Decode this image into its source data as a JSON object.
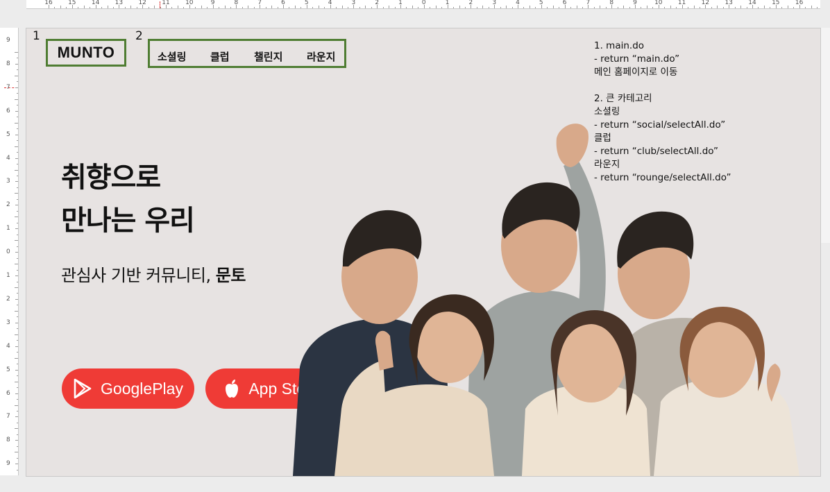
{
  "ruler": {
    "top_labels": [
      "16",
      "15",
      "14",
      "13",
      "12",
      "11",
      "10",
      "9",
      "8",
      "7",
      "6",
      "5",
      "4",
      "3",
      "2",
      "1",
      "0",
      "1",
      "2",
      "3",
      "4",
      "5",
      "6",
      "7",
      "8",
      "9",
      "10",
      "11",
      "12",
      "13",
      "14",
      "15",
      "16"
    ],
    "left_labels": [
      "9",
      "8",
      "7",
      "6",
      "5",
      "4",
      "3",
      "2",
      "1",
      "0",
      "1",
      "2",
      "3",
      "4",
      "5",
      "6",
      "7",
      "8",
      "9"
    ]
  },
  "slide": {
    "markers": {
      "logo": "1",
      "nav": "2"
    },
    "logo": "MUNTO",
    "nav": [
      "소셜링",
      "클럽",
      "챌린지",
      "라운지"
    ],
    "headline": [
      "취향으로",
      "만나는 우리"
    ],
    "subline": {
      "normal": "관심사 기반 커뮤니티, ",
      "bold": "문토"
    },
    "buttons": {
      "google": "GooglePlay",
      "apple": "App Store"
    },
    "notes": [
      "1. main.do",
      "- return “main.do”",
      "메인 홈페이지로 이동",
      "",
      "2. 큰 카테고리",
      "소셜링",
      "- return “social/selectAll.do”",
      "클럽",
      "- return “club/selectAll.do”",
      "라운지",
      "- return “rounge/selectAll.do”"
    ]
  },
  "colors": {
    "accent": "#ef3b36",
    "box_green": "#4f7d32",
    "slide_bg": "#e7e3e2",
    "sweater_navy": "#2b3442",
    "sweater_grey": "#9ea3a1",
    "sweater_cream": "#e9d9c4"
  },
  "icons": {
    "google": "google-play-icon",
    "apple": "apple-logo-icon"
  }
}
